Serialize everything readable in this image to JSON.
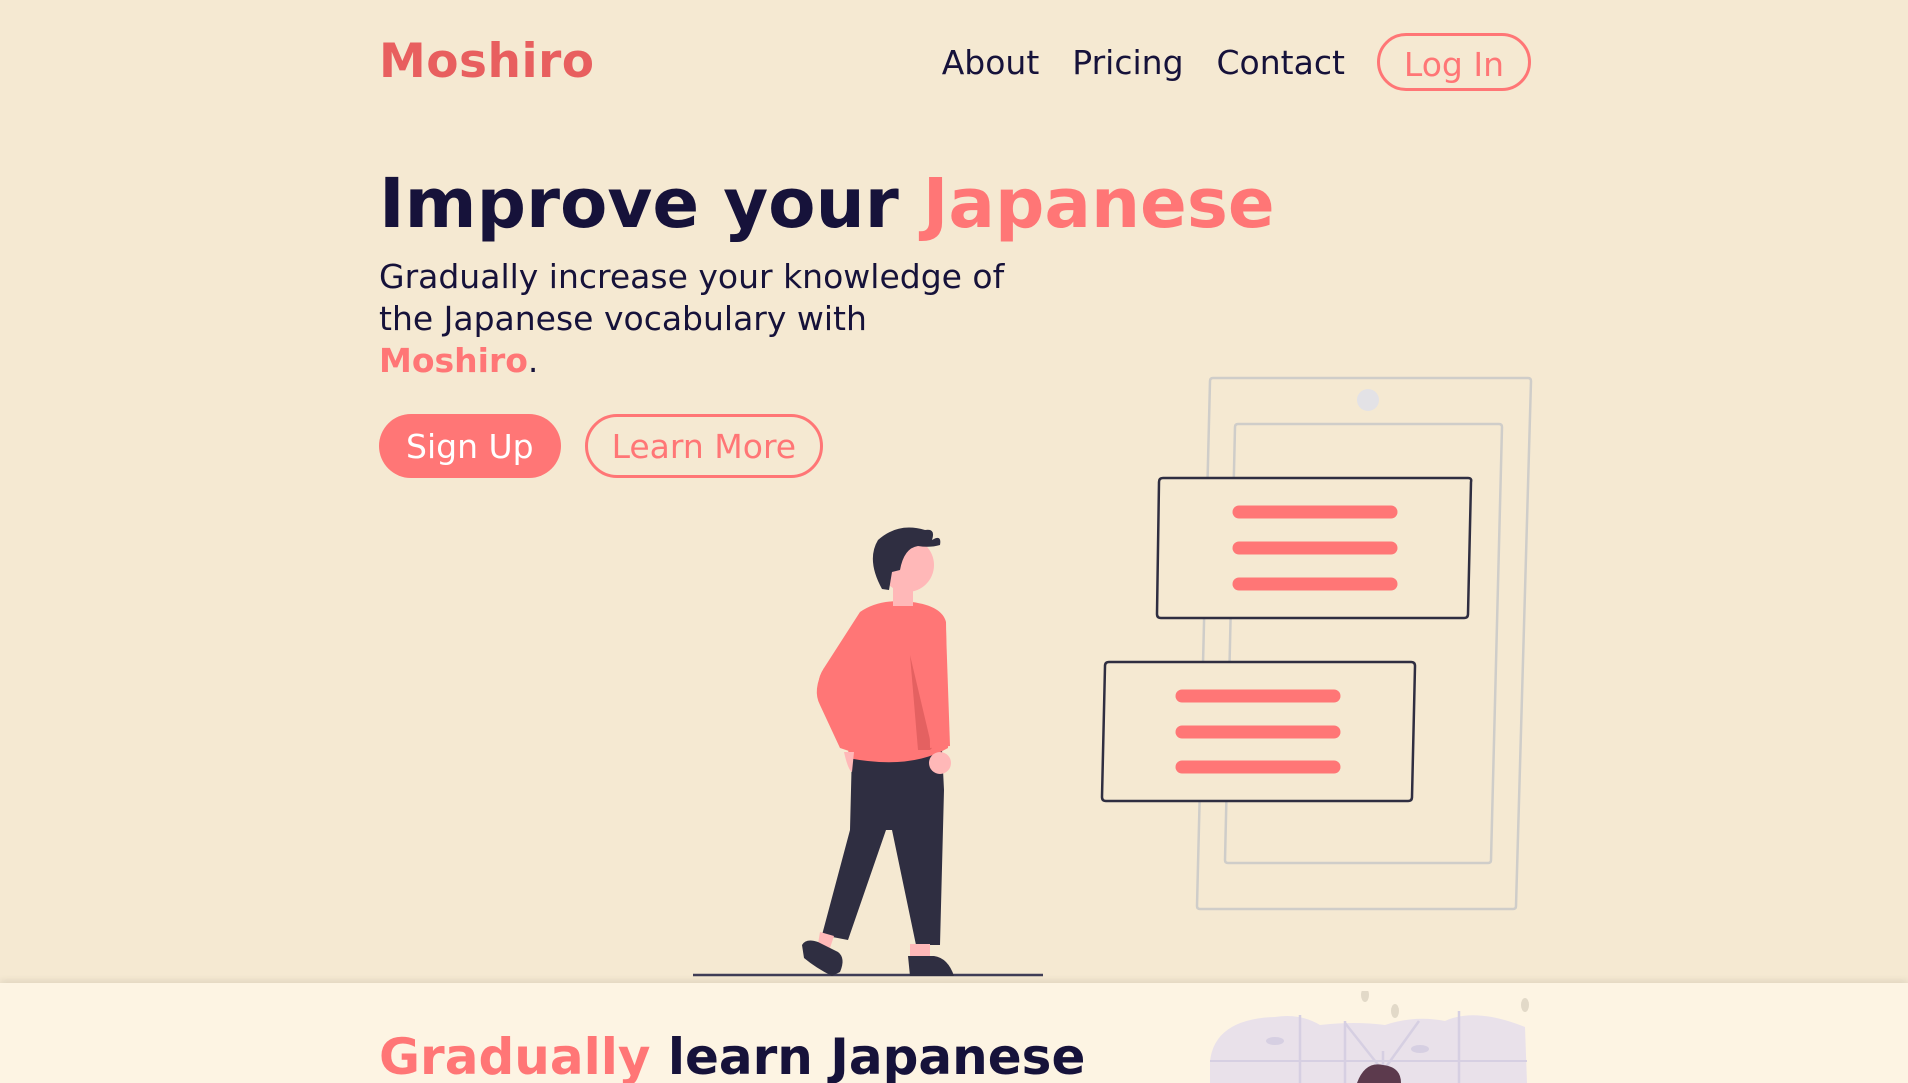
{
  "brand": {
    "name": "Moshiro"
  },
  "nav": {
    "items": [
      "About",
      "Pricing",
      "Contact"
    ],
    "login_label": "Log In"
  },
  "hero": {
    "title_prefix": "Improve your ",
    "title_accent": "Japanese",
    "subtitle": "Gradually increase your knowledge of the Japanese vocabulary with ",
    "subtitle_brand": "Moshiro",
    "subtitle_end": ".",
    "signup_label": "Sign Up",
    "learn_more_label": "Learn More"
  },
  "section2": {
    "title_accent": "Gradually",
    "title_rest": " learn Japanese"
  },
  "colors": {
    "background": "#f5e9d2",
    "accent": "#ff7676",
    "logo": "#e85f5f",
    "text": "#16123a"
  },
  "icons": [
    "person-illustration",
    "phone-chat-illustration",
    "cherry-blossom-illustration"
  ]
}
